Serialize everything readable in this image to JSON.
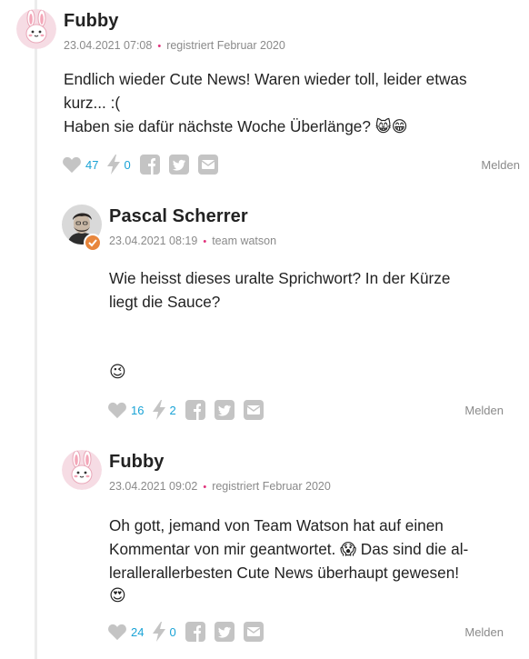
{
  "comments": [
    {
      "author": "Fubby",
      "date": "23.04.2021 07:08",
      "meta_dot": "•",
      "role": "registriert Februar 2020",
      "text_lines": [
        "Endlich wieder Cute News! Waren wieder toll, leider etwas",
        "kurz... :(",
        "Haben sie dafür nächste Woche Überlänge? 😸😁"
      ],
      "likes": "47",
      "bolts": "0",
      "report_label": "Melden",
      "avatar_icon": "bunny-avatar-icon"
    },
    {
      "author": "Pascal Scherrer",
      "date": "23.04.2021 08:19",
      "meta_dot": "•",
      "role": "team watson",
      "text_lines": [
        "Wie heisst dieses uralte Sprichwort? In der Kürze",
        "liegt die Sauce?",
        "",
        "",
        "😉"
      ],
      "likes": "16",
      "bolts": "2",
      "report_label": "Melden",
      "avatar_icon": "user-photo-avatar",
      "badge_icon": "verified-check-icon"
    },
    {
      "author": "Fubby",
      "date": "23.04.2021 09:02",
      "meta_dot": "•",
      "role": "registriert Februar 2020",
      "text_lines": [
        "Oh gott, jemand von Team Watson hat auf einen",
        "Kommentar von mir geantwortet. 😱 Das sind die al-",
        "lerallerallerbesten Cute News überhaupt gewesen!",
        "😍"
      ],
      "likes": "24",
      "bolts": "0",
      "report_label": "Melden",
      "avatar_icon": "bunny-avatar-icon"
    }
  ],
  "colors": {
    "accent_dot": "#e0317a",
    "count": "#1aa3d6",
    "icon_gray": "#c4c4c4",
    "badge": "#e8863c"
  }
}
